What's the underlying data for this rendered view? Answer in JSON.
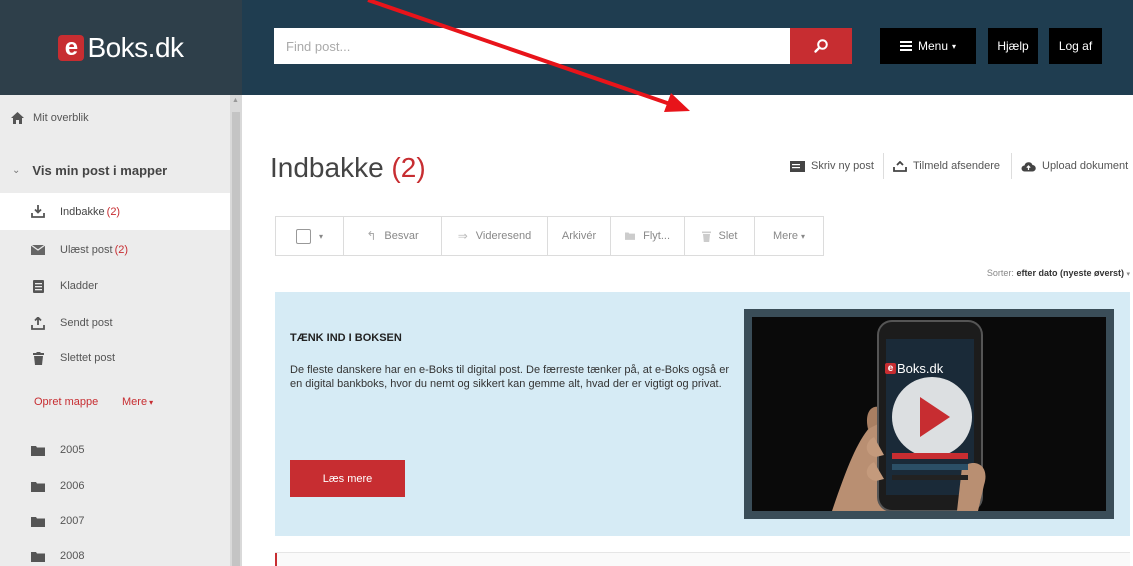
{
  "brand": {
    "e": "e",
    "name": "Boks.dk"
  },
  "search": {
    "placeholder": "Find post..."
  },
  "topnav": {
    "menu": "Menu",
    "help": "Hjælp",
    "logout": "Log af"
  },
  "sidebar": {
    "overview": "Mit overblik",
    "section": "Vis min post i mapper",
    "items": [
      {
        "label": "Indbakke",
        "count": "(2)"
      },
      {
        "label": "Ulæst post",
        "count": "(2)"
      },
      {
        "label": "Kladder",
        "count": ""
      },
      {
        "label": "Sendt post",
        "count": ""
      },
      {
        "label": "Slettet post",
        "count": ""
      }
    ],
    "create_folder": "Opret mappe",
    "more": "Mere",
    "folders": [
      "2005",
      "2006",
      "2007",
      "2008"
    ]
  },
  "main": {
    "title": "Indbakke",
    "count": "(2)",
    "actions": {
      "write": "Skriv ny post",
      "subscribe": "Tilmeld afsendere",
      "upload": "Upload dokument"
    },
    "toolbar": {
      "reply": "Besvar",
      "forward": "Videresend",
      "archive": "Arkivér",
      "move": "Flyt...",
      "delete": "Slet",
      "more": "Mere"
    },
    "sort": {
      "label": "Sorter:",
      "value": "efter dato (nyeste øverst)"
    }
  },
  "banner": {
    "title": "TÆNK IND I BOKSEN",
    "text": "De fleste danskere har en e-Boks til digital post. De færreste tænker på, at e-Boks også er en digital bankboks, hvor du nemt og sikkert kan gemme alt, hvad der er vigtigt og privat.",
    "button": "Læs mere",
    "video_brand": "Boks.dk"
  },
  "colors": {
    "accent": "#c72d31",
    "header": "#1f3d50",
    "sidebar": "#ececec",
    "banner": "#d6ebf5"
  }
}
